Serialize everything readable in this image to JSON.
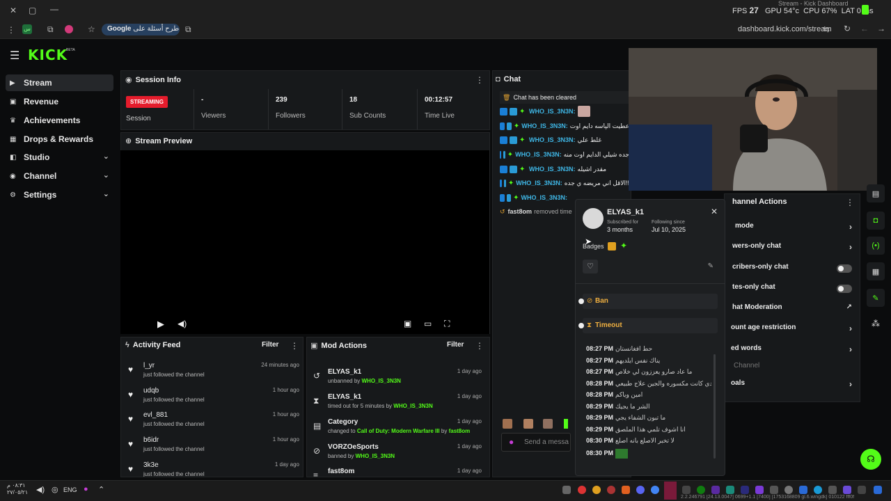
{
  "browser": {
    "google_chip": "طرح أسئلة على Google",
    "url": "dashboard.kick.com/stream",
    "overlay": {
      "fps_label": "FPS",
      "fps": "27",
      "gpu": "GPU 54°c",
      "cpu": "CPU 67%",
      "lat": "LAT 0 ms",
      "tab_title": "Stream - Kick Dashboard"
    }
  },
  "app": {
    "logo": "KICK",
    "beta": "BETA"
  },
  "sidebar": {
    "items": [
      {
        "label": "Stream",
        "icon": "stream-icon"
      },
      {
        "label": "Revenue",
        "icon": "revenue-icon"
      },
      {
        "label": "Achievements",
        "icon": "trophy-icon"
      },
      {
        "label": "Drops & Rewards",
        "icon": "gift-icon"
      },
      {
        "label": "Studio",
        "icon": "studio-icon"
      },
      {
        "label": "Channel",
        "icon": "channel-icon"
      },
      {
        "label": "Settings",
        "icon": "gear-icon"
      }
    ]
  },
  "session": {
    "title": "Session Info",
    "status": "STREAMING",
    "status_label": "Session",
    "viewers_value": "-",
    "viewers_label": "Viewers",
    "followers_value": "239",
    "followers_label": "Followers",
    "subs_value": "18",
    "subs_label": "Sub Counts",
    "time_value": "00:12:57",
    "time_label": "Time Live"
  },
  "preview": {
    "title": "Stream Preview"
  },
  "activity": {
    "title": "Activity Feed",
    "filter": "Filter",
    "rows": [
      {
        "name": "l_yr",
        "sub": "just followed the channel",
        "time": "24 minutes ago"
      },
      {
        "name": "udqb",
        "sub": "just followed the channel",
        "time": "1 hour ago"
      },
      {
        "name": "evl_881",
        "sub": "just followed the channel",
        "time": "1 hour ago"
      },
      {
        "name": "b6idr",
        "sub": "just followed the channel",
        "time": "1 hour ago"
      },
      {
        "name": "3k3e",
        "sub": "just followed the channel",
        "time": "1 day ago"
      }
    ]
  },
  "mod_actions": {
    "title": "Mod Actions",
    "filter": "Filter",
    "rows": [
      {
        "name": "ELYAS_k1",
        "pre": "unbanned by",
        "who": "WHO_IS_3N3N",
        "mid": "",
        "who2": "",
        "time": "1 day ago"
      },
      {
        "name": "ELYAS_k1",
        "pre": "timed out for 5 minutes by",
        "who": "WHO_IS_3N3N",
        "mid": "",
        "who2": "",
        "time": "1 day ago"
      },
      {
        "name": "Category",
        "pre": "changed to",
        "who": "Call of Duty: Modern Warfare III",
        "mid": "by",
        "who2": "fast8om",
        "time": "1 day ago"
      },
      {
        "name": "VORZOeSports",
        "pre": "banned by",
        "who": "WHO_IS_3N3N",
        "mid": "",
        "who2": "",
        "time": "1 day ago"
      },
      {
        "name": "fast8om",
        "pre": "",
        "who": "",
        "mid": "",
        "who2": "",
        "time": "1 day ago"
      }
    ]
  },
  "chat": {
    "title": "Chat",
    "cleared": "Chat has been cleared",
    "lines": [
      {
        "user": "WHO_IS_3N3N:",
        "msg": ""
      },
      {
        "user": "WHO_IS_3N3N:",
        "msg": "عطيت الپاسه دايم اوت"
      },
      {
        "user": "WHO_IS_3N3N:",
        "msg": "غلط علي"
      },
      {
        "user": "WHO_IS_3N3N:",
        "msg": "جده شيلي الدايم اوت منه"
      },
      {
        "user": "WHO_IS_3N3N:",
        "msg": "مقدر اشيله"
      },
      {
        "user": "WHO_IS_3N3N:",
        "msg": "الاقل اني مريضه ي جده!!"
      },
      {
        "user": "WHO_IS_3N3N:",
        "msg": ""
      }
    ],
    "removed_user": "fast8om",
    "removed_text": "removed time",
    "send_placeholder": "Send a messa"
  },
  "popup": {
    "username": "ELYAS_k1",
    "subscribed_label": "Subscribed for",
    "subscribed_value": "3 months",
    "following_label": "Following since",
    "following_value": "Jul 10, 2025",
    "badges_label": "Badges",
    "ban_label": "Ban",
    "timeout_label": "Timeout",
    "log": [
      {
        "t": "08:27 PM",
        "m": "حط افغانستان"
      },
      {
        "t": "08:27 PM",
        "m": "يناك نفس ايلديهم"
      },
      {
        "t": "08:27 PM",
        "m": "ما عاد صارو يعززون لي خلاص"
      },
      {
        "t": "08:28 PM",
        "m": "لا بدي كانت مكسوره والجين علاج طبيعي"
      },
      {
        "t": "08:28 PM",
        "m": "امين وياكم"
      },
      {
        "t": "08:29 PM",
        "m": "الشر ما يجيك"
      },
      {
        "t": "08:29 PM",
        "m": "ما تبون الشفاء يجي"
      },
      {
        "t": "08:29 PM",
        "m": "انا اشوف تلمي هذا الملصق"
      },
      {
        "t": "08:30 PM",
        "m": "لا تخبر الاصلع بانه اصلع"
      },
      {
        "t": "08:30 PM",
        "m": ""
      }
    ]
  },
  "channel_actions": {
    "title": "hannel Actions",
    "rows": [
      {
        "label": "mode",
        "kind": "chev"
      },
      {
        "label": "wers-only chat",
        "kind": "chev"
      },
      {
        "label": "cribers-only chat",
        "kind": "toggle"
      },
      {
        "label": "tes-only chat",
        "kind": "toggle"
      },
      {
        "label": "hat Moderation",
        "kind": "ext"
      },
      {
        "label": "ount age restriction",
        "kind": "chev"
      },
      {
        "label": "ed words",
        "kind": "chev"
      },
      {
        "label": "Channel",
        "kind": "section"
      },
      {
        "label": "oals",
        "kind": "chev"
      }
    ]
  },
  "taskbar": {
    "lang": "ENG",
    "time": "٠٨:٣١ م",
    "date": "٢٧/٠٥/٢١",
    "status_text": "2.2.246791 [24.13.0047] 0699+1.1 [7400] [1753168809 gl.6.wingdk] 010122 fff0f"
  }
}
